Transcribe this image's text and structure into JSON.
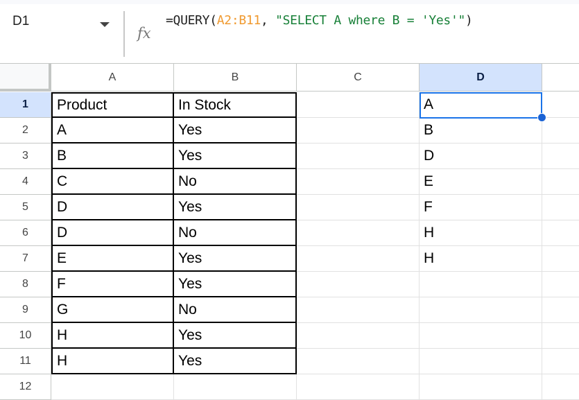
{
  "name_box": {
    "value": "D1"
  },
  "formula_bar": {
    "fx_icon": "fx-icon",
    "formula_parts": [
      {
        "text": "=QUERY(",
        "type": "plain"
      },
      {
        "text": "A2:B11",
        "type": "range"
      },
      {
        "text": ", ",
        "type": "plain"
      },
      {
        "text": "\"SELECT A where B = 'Yes'\"",
        "type": "string"
      },
      {
        "text": ")",
        "type": "plain"
      }
    ]
  },
  "columns": [
    "A",
    "B",
    "C",
    "D"
  ],
  "selected_column": "D",
  "rows": [
    "1",
    "2",
    "3",
    "4",
    "5",
    "6",
    "7",
    "8",
    "9",
    "10",
    "11",
    "12"
  ],
  "selected_row": "1",
  "table": {
    "headers": [
      "Product",
      "In Stock"
    ],
    "data": [
      [
        "A",
        "Yes"
      ],
      [
        "B",
        "Yes"
      ],
      [
        "C",
        "No"
      ],
      [
        "D",
        "Yes"
      ],
      [
        "D",
        "No"
      ],
      [
        "E",
        "Yes"
      ],
      [
        "F",
        "Yes"
      ],
      [
        "G",
        "No"
      ],
      [
        "H",
        "Yes"
      ],
      [
        "H",
        "Yes"
      ]
    ]
  },
  "query_result": [
    "A",
    "B",
    "D",
    "E",
    "F",
    "H",
    "H"
  ],
  "active_cell": "D1",
  "colors": {
    "selection": "#1a73e8",
    "header_selected": "#d3e3fd",
    "range_ref": "#f09a30",
    "string_literal": "#188038"
  }
}
